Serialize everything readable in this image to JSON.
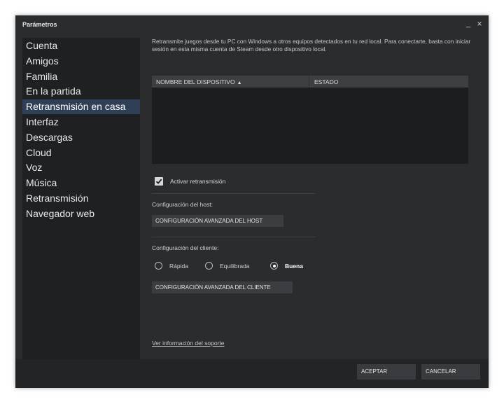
{
  "window": {
    "title": "Parámetros"
  },
  "controls": {
    "minimize": "_",
    "close": "×"
  },
  "sidebar": {
    "items": [
      {
        "label": "Cuenta"
      },
      {
        "label": "Amigos"
      },
      {
        "label": "Familia"
      },
      {
        "label": "En la partida"
      },
      {
        "label": "Retransmisión en casa",
        "active": true
      },
      {
        "label": "Interfaz"
      },
      {
        "label": "Descargas"
      },
      {
        "label": "Cloud"
      },
      {
        "label": "Voz"
      },
      {
        "label": "Música"
      },
      {
        "label": "Retransmisión"
      },
      {
        "label": "Navegador web"
      }
    ]
  },
  "main": {
    "description": "Retransmite juegos desde tu PC con Windows a otros equipos detectados en tu red local. Para conectarte, basta con iniciar sesión en esta misma cuenta de Steam desde otro dispositivo local.",
    "table": {
      "col_device": "NOMBRE DEL DISPOSITIVO",
      "col_status": "ESTADO",
      "sort_indicator": "▲",
      "rows": []
    },
    "enable_streaming": {
      "label": "Activar retransmisión",
      "checked": true
    },
    "host": {
      "label": "Configuración del host:",
      "button": "CONFIGURACIÓN AVANZADA DEL HOST"
    },
    "client": {
      "label": "Configuración del cliente:",
      "options": [
        "Rápida",
        "Equilibrada",
        "Buena"
      ],
      "selected": "Buena",
      "button": "CONFIGURACIÓN AVANZADA DEL CLIENTE"
    },
    "support_link": "Ver información del soporte"
  },
  "footer": {
    "accept": "ACEPTAR",
    "cancel": "CANCELAR"
  }
}
